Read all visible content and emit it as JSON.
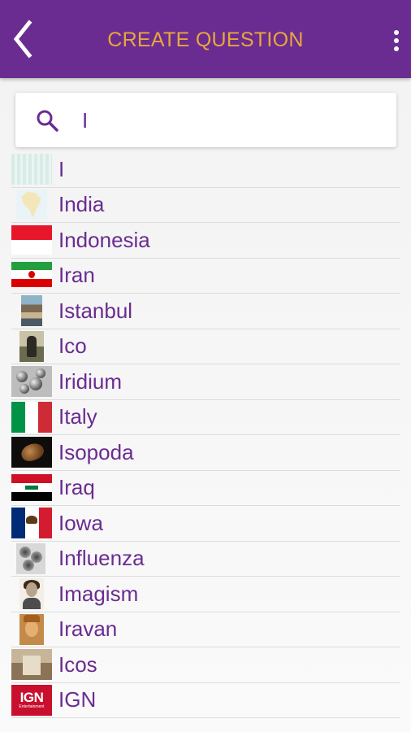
{
  "header": {
    "title": "CREATE QUESTION",
    "back_icon": "chevron-left-icon",
    "menu_icon": "more-vertical-icon"
  },
  "search": {
    "value": "I",
    "icon": "search-icon"
  },
  "results": [
    {
      "label": "I",
      "thumb": "grid-pattern-image"
    },
    {
      "label": "India",
      "thumb": "india-map-image"
    },
    {
      "label": "Indonesia",
      "thumb": "indonesia-flag"
    },
    {
      "label": "Iran",
      "thumb": "iran-flag"
    },
    {
      "label": "Istanbul",
      "thumb": "istanbul-photo"
    },
    {
      "label": "Ico",
      "thumb": "ico-cover-image"
    },
    {
      "label": "Iridium",
      "thumb": "iridium-photo"
    },
    {
      "label": "Italy",
      "thumb": "italy-flag"
    },
    {
      "label": "Isopoda",
      "thumb": "isopoda-photo"
    },
    {
      "label": "Iraq",
      "thumb": "iraq-flag"
    },
    {
      "label": "Iowa",
      "thumb": "iowa-flag"
    },
    {
      "label": "Influenza",
      "thumb": "influenza-virus-image"
    },
    {
      "label": "Imagism",
      "thumb": "imagism-portrait"
    },
    {
      "label": "Iravan",
      "thumb": "iravan-image"
    },
    {
      "label": "Icos",
      "thumb": "icos-photo"
    },
    {
      "label": "IGN",
      "thumb": "ign-logo"
    }
  ],
  "colors": {
    "header_bg": "#6a2c91",
    "title_color": "#e8a73c",
    "label_color": "#6a2c91"
  }
}
